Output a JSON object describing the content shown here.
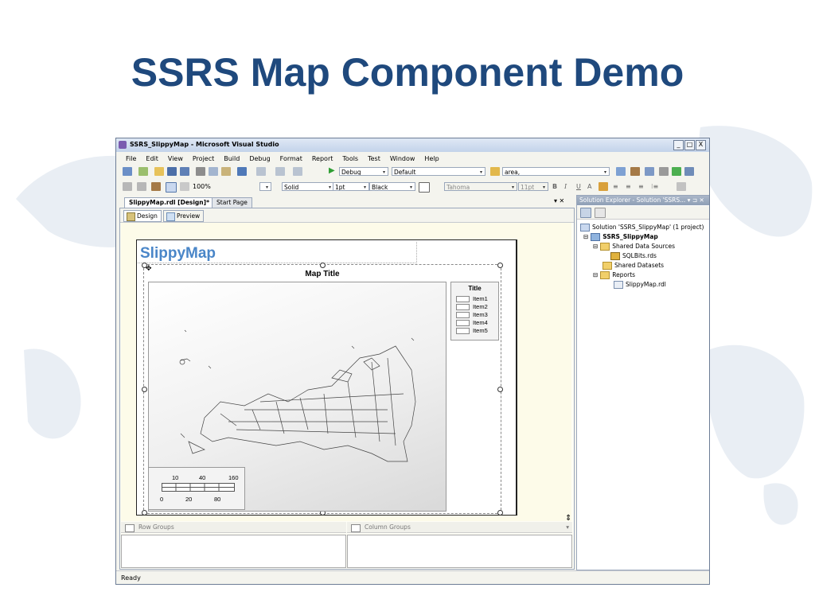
{
  "slide": {
    "title": "SSRS Map Component Demo"
  },
  "window": {
    "title": "SSRS_SlippyMap - Microsoft Visual Studio",
    "controls": {
      "minimize": "_",
      "maximize": "□",
      "close": "X"
    }
  },
  "menu": [
    "File",
    "Edit",
    "View",
    "Project",
    "Build",
    "Debug",
    "Format",
    "Report",
    "Tools",
    "Test",
    "Window",
    "Help"
  ],
  "toolbar": {
    "config": "Debug",
    "platform": "Default",
    "find": "area,",
    "zoom": "100%",
    "line_style": "Solid",
    "line_width": "1pt",
    "line_color": "Black",
    "font": "Tahoma",
    "font_size": "11pt",
    "bold": "B",
    "italic": "I",
    "underline": "U",
    "font_color": "A"
  },
  "document_tabs": {
    "active": "SlippyMap.rdl [Design]*",
    "other": "Start Page",
    "controls": "▾ ✕"
  },
  "sub_tabs": {
    "design": "Design",
    "preview": "Preview"
  },
  "report": {
    "title": "SlippyMap",
    "map_title": "Map Title",
    "legend": {
      "title": "Title",
      "items": [
        "Item1",
        "Item2",
        "Item3",
        "Item4",
        "Item5"
      ]
    },
    "scale": {
      "top": [
        "10",
        "40",
        "160"
      ],
      "bottom": [
        "0",
        "20",
        "80"
      ]
    }
  },
  "groups": {
    "row": "Row Groups",
    "column": "Column Groups"
  },
  "solution_explorer": {
    "header": "Solution Explorer - Solution 'SSRS... ▾ ⊐ ✕",
    "nodes": [
      "Solution 'SSRS_SlippyMap' (1 project)",
      "SSRS_SlippyMap",
      "Shared Data Sources",
      "SQLBits.rds",
      "Shared Datasets",
      "Reports",
      "SlippyMap.rdl"
    ]
  },
  "status": "Ready",
  "icons": [
    "app-icon",
    "design-icon",
    "preview-icon",
    "folder-icon",
    "project-icon",
    "solution-icon",
    "datasource-icon",
    "report-file-icon",
    "row-groups-icon",
    "column-groups-icon",
    "move-handle-icon"
  ]
}
